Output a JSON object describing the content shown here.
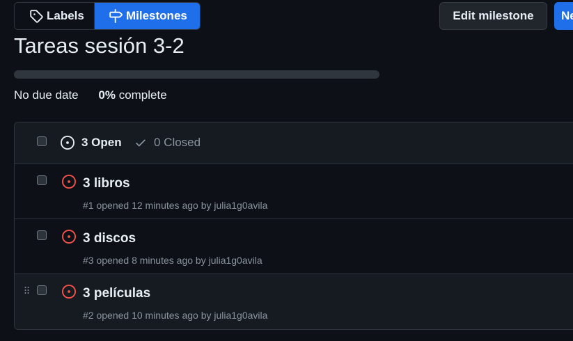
{
  "toolbar": {
    "labels_label": "Labels",
    "milestones_label": "Milestones",
    "edit_label": "Edit milestone",
    "new_label": "New issue"
  },
  "milestone": {
    "title": "Tareas sesión 3-2",
    "due": "No due date",
    "percent": "0%",
    "complete_word": "complete",
    "progress_fraction": 0
  },
  "list": {
    "open_label": "3 Open",
    "closed_label": "0 Closed",
    "issues": [
      {
        "title": "3 libros",
        "meta": "#1 opened 12 minutes ago by julia1g0avila"
      },
      {
        "title": "3 discos",
        "meta": "#3 opened 8 minutes ago by julia1g0avila"
      },
      {
        "title": "3 películas",
        "meta": "#2 opened 10 minutes ago by julia1g0avila"
      }
    ]
  },
  "colors": {
    "background": "#0d1117",
    "accent": "#1f6feb",
    "open_issue": "#f85149",
    "muted": "#8b949e"
  },
  "icons": {
    "labels": "tag-icon",
    "milestones": "milestone-icon",
    "open": "issue-opened-icon",
    "closed": "check-icon",
    "drag": "grabber-icon"
  }
}
